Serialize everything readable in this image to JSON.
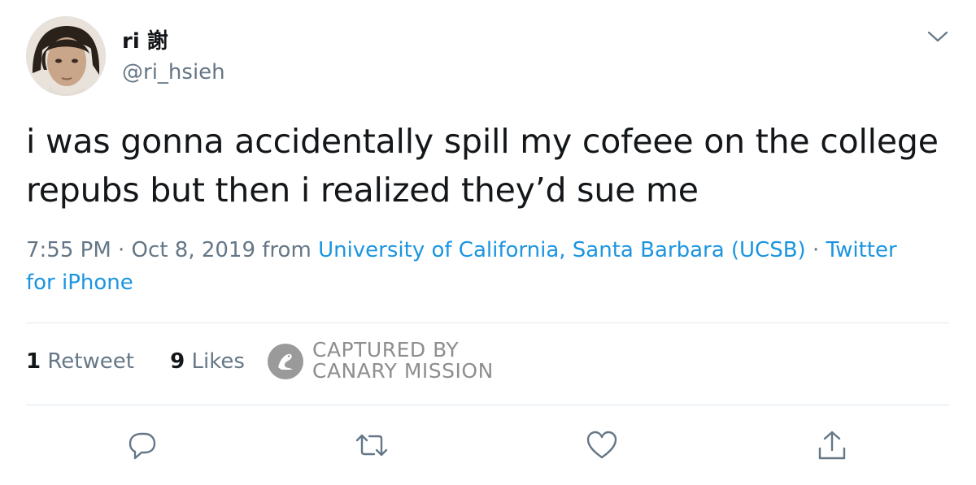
{
  "author": {
    "name": "ri 謝",
    "handle": "@ri_hsieh",
    "avatar_icon": "user-avatar-photo"
  },
  "tweet": {
    "line1": "i was gonna accidentally spill my cofeee on the college",
    "line2": "repubs but then i realized they’d sue me"
  },
  "meta": {
    "time": "7:55 PM · Oct 8, 2019",
    "from": " from ",
    "location": "University of California, Santa Barbara (UCSB)",
    "separator": " · ",
    "source": "Twitter for iPhone"
  },
  "stats": {
    "retweets_count": "1",
    "retweets_label": " Retweet",
    "likes_count": "9",
    "likes_label": " Likes"
  },
  "watermark": {
    "line1": "CAPTURED BY",
    "line2": "CANARY MISSION"
  },
  "colors": {
    "link": "#1b95e0",
    "secondary_text": "#657786",
    "primary_text": "#14171a",
    "divider": "#e1e8ed"
  },
  "icons": [
    "chevron-down-icon",
    "reply-icon",
    "retweet-icon",
    "like-icon",
    "share-icon",
    "canary-logo-icon"
  ]
}
